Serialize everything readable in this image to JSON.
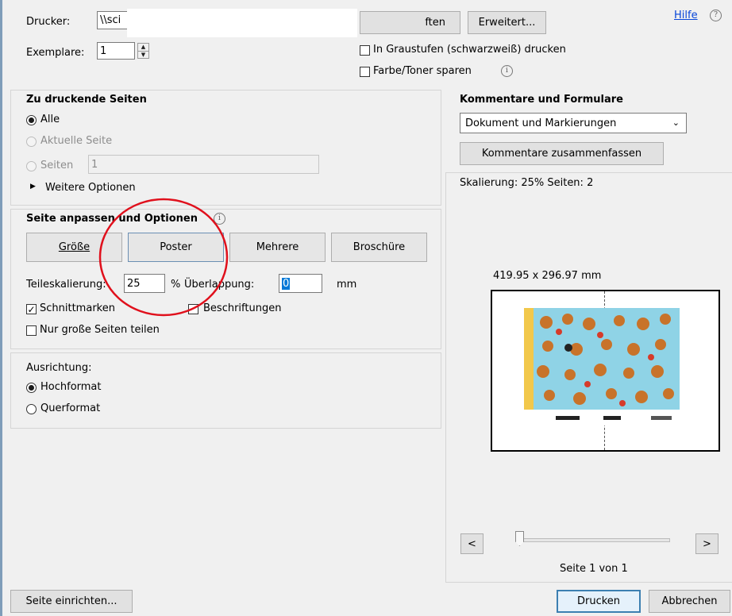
{
  "printer": {
    "label": "Drucker:",
    "value": "\\\\sci",
    "properties_button": "ften",
    "advanced_button": "Erweitert...",
    "help_link": "Hilfe",
    "help_icon": "?",
    "copies_label": "Exemplare:",
    "copies_value": "1",
    "grayscale_label": "In Graustufen (schwarzweiß) drucken",
    "grayscale_checked": false,
    "save_toner_label": "Farbe/Toner sparen",
    "save_toner_checked": false,
    "info_icon": "i"
  },
  "pages_to_print": {
    "title": "Zu druckende Seiten",
    "all_label": "Alle",
    "current_label": "Aktuelle Seite",
    "pages_label": "Seiten",
    "pages_value": "1",
    "more_options_label": "Weitere Optionen",
    "selected": "all"
  },
  "page_fit": {
    "title": "Seite anpassen und Optionen",
    "info_icon": "i",
    "buttons": [
      "Größe",
      "Poster",
      "Mehrere",
      "Broschüre"
    ],
    "tile_scale_label": "Teileskalierung:",
    "tile_scale_value": "25",
    "tile_scale_unit": "%",
    "overlap_label": "Überlappung:",
    "overlap_value": "0",
    "overlap_unit": "mm",
    "cut_marks_label": "Schnittmarken",
    "cut_marks_checked": true,
    "labels_label": "Beschriftungen",
    "labels_checked": false,
    "large_pages_label": "Nur große Seiten teilen",
    "large_pages_checked": false
  },
  "orientation": {
    "title": "Ausrichtung:",
    "portrait_label": "Hochformat",
    "landscape_label": "Querformat",
    "selected": "portrait"
  },
  "comments": {
    "title": "Kommentare und Formulare",
    "select_value": "Dokument und Markierungen",
    "summarize_button": "Kommentare zusammenfassen"
  },
  "preview": {
    "scaling_text": "Skalierung:  25% Seiten: 2",
    "page_size": "419.95 x 296.97 mm",
    "prev_button": "<",
    "next_button": ">",
    "page_indicator": "Seite 1 von 1"
  },
  "footer": {
    "page_setup_button": "Seite einrichten...",
    "print_button": "Drucken",
    "cancel_button": "Abbrechen"
  },
  "colors": {
    "highlight_circle": "#e0101c",
    "link": "#0645d9",
    "panel_bg": "#f0f0f0"
  }
}
